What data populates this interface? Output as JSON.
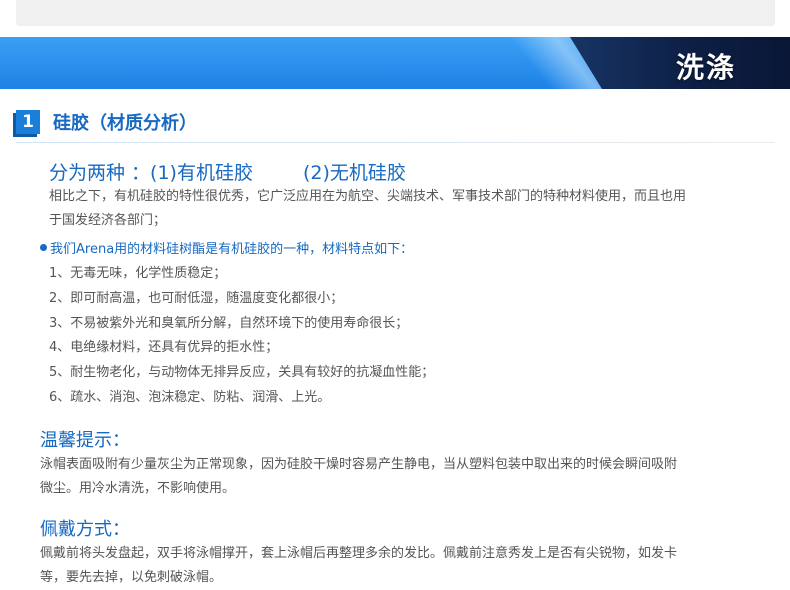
{
  "banner": {
    "title": "洗涤"
  },
  "section": {
    "number": "1",
    "title": "硅胶（材质分析）"
  },
  "types": {
    "intro": "分为两种 ：(1)有机硅胶",
    "second": "(2)无机硅胶"
  },
  "intro_paragraph": [
    "相比之下，有机硅胶的特性很优秀，它广泛应用在为航空、尖端技术、军事技术部门的特种材料使用，而且也用",
    "于国发经济各部门；"
  ],
  "features": {
    "heading": "我们Arena用的材料硅树酯是有机硅胶的一种，材料特点如下：",
    "items": [
      "1、无毒无味，化学性质稳定；",
      "2、即可耐高温，也可耐低湿，随温度变化都很小；",
      "3、不易被紫外光和臭氧所分解，自然环境下的使用寿命很长；",
      "4、电绝缘材料，还具有优异的拒水性；",
      "5、耐生物老化，与动物体无排异反应，关具有较好的抗凝血性能；",
      "6、疏水、消泡、泡沫稳定、防粘、润滑、上光。"
    ]
  },
  "tip": {
    "heading": "温馨提示：",
    "lines": [
      "泳帽表面吸附有少量灰尘为正常现象，因为硅胶干燥时容易产生静电，当从塑料包装中取出来的时候会瞬间吸附",
      "微尘。用冷水清洗，不影响使用。"
    ]
  },
  "wear": {
    "heading": "佩戴方式：",
    "lines": [
      "佩戴前将头发盘起，双手将泳帽撑开，套上泳帽后再整理多余的发比。佩戴前注意秀发上是否有尖锐物，如发卡",
      "等，要先去掉，以免刺破泳帽。"
    ]
  },
  "colors": {
    "accent": "#1769c2",
    "banner_blue": "#2a90ee",
    "banner_dark": "#0d1f45",
    "text": "#555555"
  }
}
